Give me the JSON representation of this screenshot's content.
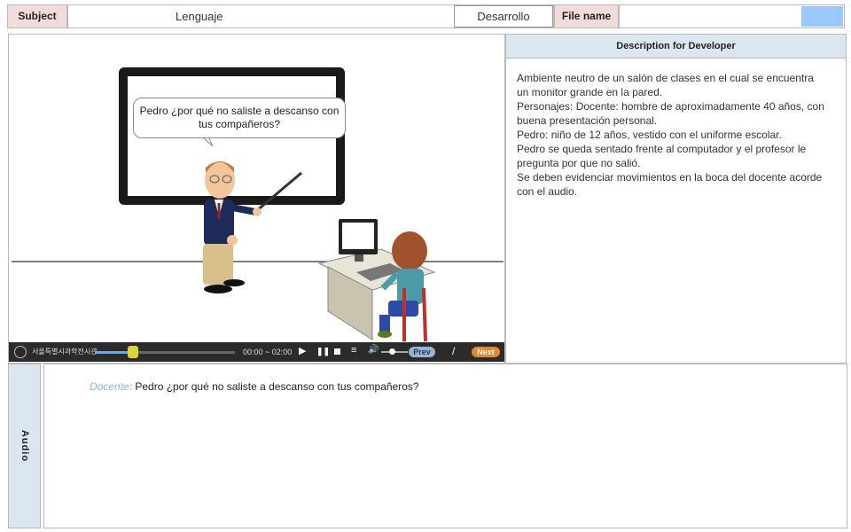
{
  "header": {
    "subject_label": "Subject",
    "subject_value": "Lenguaje",
    "stage_value": "Desarrollo",
    "file_name_label": "File name"
  },
  "scene": {
    "speech_bubble": "Pedro ¿por qué no saliste a descanso con tus compañeros?"
  },
  "player": {
    "logo_text": "서울특별시과학전시관",
    "time": "00:00 ~ 02:00",
    "progress": 0.27,
    "volume": 0.4,
    "prev_label": "Prev",
    "separator": "/",
    "next_label": "Next"
  },
  "description": {
    "title": "Description for Developer",
    "lines": [
      "Ambiente neutro  de un salón de clases en el cual se encuentra un monitor grande en la pared.",
      "Personajes: Docente: hombre de aproximadamente 40 años, con buena presentación personal.",
      "Pedro: niño de 12 años, vestido con el uniforme escolar.",
      "Pedro se queda sentado frente al computador  y el profesor le pregunta por que no salió.",
      "Se deben evidenciar movimientos en la boca del docente acorde con el audio."
    ]
  },
  "audio": {
    "tab_label": "Audio",
    "speaker": "Docente:",
    "line": "Pedro ¿por qué no saliste a descanso con tus compañeros?"
  },
  "colors": {
    "label_pink": "#f2dcdb",
    "panel_blue": "#dce6f1",
    "accent_blue": "#99c9ff",
    "next_orange": "#e8862d"
  }
}
